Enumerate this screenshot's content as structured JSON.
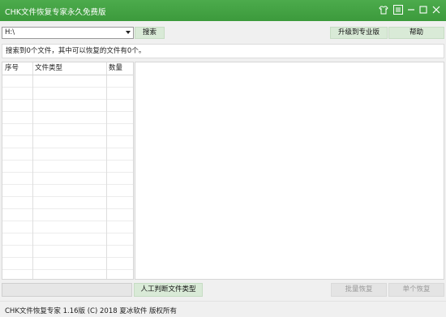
{
  "window": {
    "title": "CHK文件恢复专家永久免费版",
    "controls": [
      "shirt-icon",
      "menu-icon",
      "minimize-icon",
      "maximize-icon",
      "close-icon"
    ],
    "accent_color": "#45a345"
  },
  "toolbar": {
    "drive": {
      "value": "H:\\"
    },
    "search_label": "搜索",
    "upgrade_label": "升级到专业版",
    "help_label": "帮助"
  },
  "status": {
    "text": "搜索到0个文件，其中可以恢复的文件有0个。"
  },
  "result_table": {
    "columns": [
      "序号",
      "文件类型",
      "数量"
    ],
    "rows": []
  },
  "progress": {
    "percent": 0
  },
  "actions": {
    "manual_detect_label": "人工判断文件类型",
    "batch_recover_label": "批量恢复",
    "single_recover_label": "单个恢复"
  },
  "footer": {
    "text": "CHK文件恢复专家 1.16版 (C) 2018 夏冰软件 版权所有"
  }
}
